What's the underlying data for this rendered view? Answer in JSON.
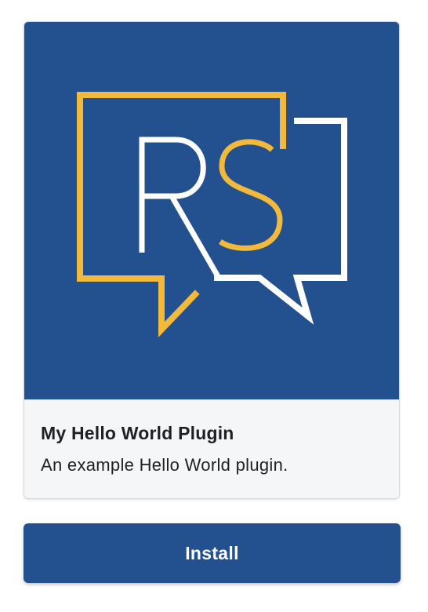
{
  "plugin": {
    "logo": {
      "icon": "rs-speech-bubbles-logo-icon",
      "letters": "RS",
      "colors": {
        "background": "#23508f",
        "gold": "#f2b93b",
        "white": "#ffffff"
      }
    },
    "title": "My Hello World Plugin",
    "description": "An example Hello World plugin."
  },
  "actions": {
    "install_label": "Install"
  }
}
